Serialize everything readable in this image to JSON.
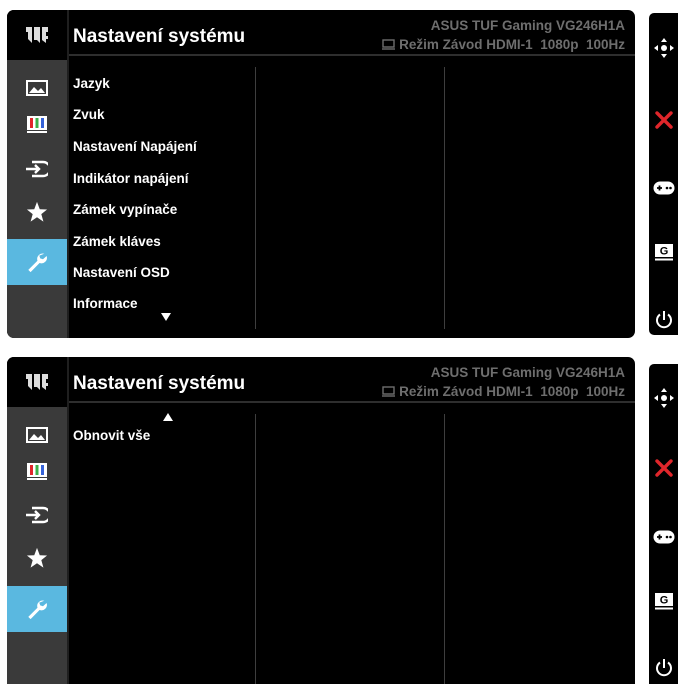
{
  "screens": [
    {
      "title": "Nastavení systému",
      "model": "ASUS TUF Gaming VG246H1A",
      "status": "Režim Závod HDMI-1  1080p  100Hz",
      "items": [
        "Jazyk",
        "Zvuk",
        "Nastavení Napájení",
        "Indikátor napájení",
        "Zámek vypínače",
        "Zámek kláves",
        "Nastavení OSD",
        "Informace"
      ],
      "scroll": "down"
    },
    {
      "title": "Nastavení systému",
      "model": "ASUS TUF Gaming VG246H1A",
      "status": "Režim Závod HDMI-1  1080p  100Hz",
      "items": [
        "Obnovit vše"
      ],
      "scroll": "up"
    }
  ],
  "sidebar_icons": [
    "tuf-logo",
    "image-icon",
    "color-icon",
    "input-icon",
    "favorite-star-icon",
    "system-wrench-icon"
  ],
  "sidebar_active": "system-wrench-icon",
  "key_icons": [
    "five-way-navigation-icon",
    "close-icon",
    "gameplus-icon",
    "gamevisual-icon",
    "power-icon"
  ],
  "colors": {
    "active": "#5ab8e0",
    "close": "#e0262b",
    "text": "#ffffff",
    "muted": "#6e6e6e"
  }
}
